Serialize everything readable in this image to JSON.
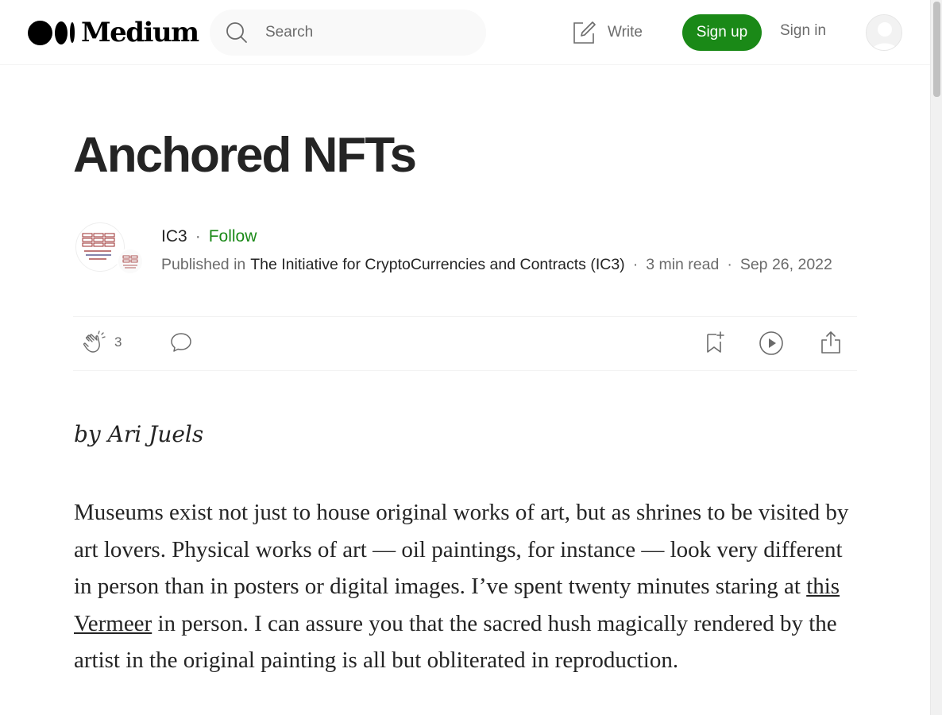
{
  "nav": {
    "logo_text": "Medium",
    "search_placeholder": "Search",
    "write_label": "Write",
    "signup_label": "Sign up",
    "signin_label": "Sign in"
  },
  "article": {
    "title": "Anchored NFTs",
    "author": "IC3",
    "follow_label": "Follow",
    "published_in_label": "Published in",
    "publication": "The Initiative for CryptoCurrencies and Contracts (IC3)",
    "read_time": "3 min read",
    "date": "Sep 26, 2022",
    "clap_count": "3",
    "byline": "by Ari Juels",
    "paragraph": {
      "part1": "Museums exist not just to house original works of art, but as shrines to be visited by art lovers. Physical works of art — oil paintings, for instance — look very different in person than in posters or digital images. I’ve spent twenty minutes staring at ",
      "link": "this Vermeer",
      "part2": " in person. I can assure you that the sacred hush magically rendered by the artist in the original painting is all but obliterated in reproduction."
    }
  },
  "colors": {
    "brand_green": "#1a8917",
    "text": "#242424",
    "muted": "#6b6b6b",
    "search_bg": "#f9f9f9"
  },
  "icons": [
    "search-icon",
    "write-icon",
    "user-icon",
    "clap-icon",
    "comment-icon",
    "bookmark-add-icon",
    "play-icon",
    "share-icon"
  ]
}
